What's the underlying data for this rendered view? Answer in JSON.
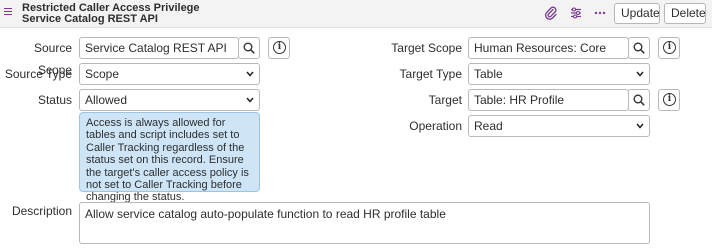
{
  "header": {
    "title_line1": "Restricted Caller Access Privilege",
    "title_line2": "Service Catalog REST API",
    "update_label": "Update",
    "delete_label": "Delete"
  },
  "form": {
    "source_scope": {
      "label": "Source Scope",
      "value": "Service Catalog REST API"
    },
    "source_type": {
      "label": "Source Type",
      "value": "Scope"
    },
    "status": {
      "label": "Status",
      "value": "Allowed"
    },
    "status_note": "Access is always allowed for tables and script includes set to Caller Tracking regardless of the status set on this record. Ensure the target's caller access policy is not set to Caller Tracking before changing the status.",
    "target_scope": {
      "label": "Target Scope",
      "value": "Human Resources: Core"
    },
    "target_type": {
      "label": "Target Type",
      "value": "Table"
    },
    "target": {
      "label": "Target",
      "value": "Table: HR Profile"
    },
    "operation": {
      "label": "Operation",
      "value": "Read"
    },
    "description": {
      "label": "Description",
      "value": "Allow service catalog auto-populate function to read HR profile table"
    }
  },
  "colors": {
    "accent": "#7a3b8f",
    "note_bg": "#cde5f7",
    "header_bg": "#f3f3f3"
  },
  "icons": [
    "menu-icon",
    "paperclip-icon",
    "settings-sliders-icon",
    "more-icon",
    "search-icon",
    "info-icon",
    "chevron-down-icon"
  ]
}
